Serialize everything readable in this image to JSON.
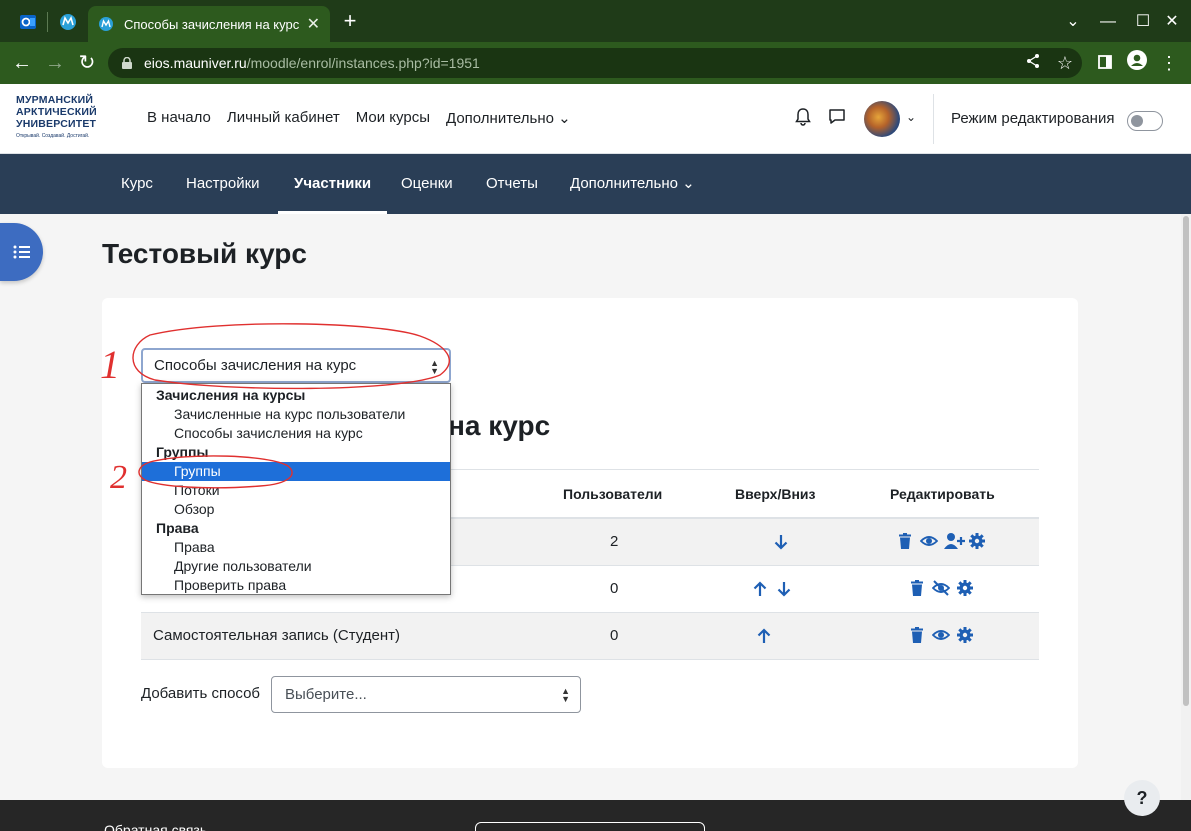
{
  "browser": {
    "tab_title": "Способы зачисления на курс",
    "tab_close": "✕",
    "new_tab": "+",
    "url_host": "eios.mauniver.ru",
    "url_path": "/moodle/enrol/instances.php?id=1951",
    "window_controls": [
      "⌄",
      "—",
      "☐",
      "✕"
    ]
  },
  "site": {
    "logo_lines": [
      "МУРМАНСКИЙ",
      "АРКТИЧЕСКИЙ",
      "УНИВЕРСИТЕТ"
    ],
    "logo_tagline": "Открывай. Создавай. Достигай.",
    "primary_nav": [
      "В начало",
      "Личный кабинет",
      "Мои курсы",
      "Дополнительно ⌄"
    ],
    "edit_mode_label": "Режим редактирования"
  },
  "secondary_nav": {
    "items": [
      "Курс",
      "Настройки",
      "Участники",
      "Оценки",
      "Отчеты",
      "Дополнительно ⌄"
    ],
    "active": "Участники"
  },
  "page": {
    "title": "Тестовый курс",
    "nav_select_value": "Способы зачисления на курс",
    "section_heading": "на курс",
    "add_method_label": "Добавить способ",
    "add_method_placeholder": "Выберите..."
  },
  "table": {
    "headers": [
      "Пользователи",
      "Вверх/Вниз",
      "Редактировать"
    ],
    "rows": [
      {
        "name": "",
        "users": "2"
      },
      {
        "name": "",
        "users": "0"
      },
      {
        "name": "Самостоятельная запись (Студент)",
        "users": "0"
      }
    ]
  },
  "dropdown": {
    "groups": [
      {
        "label": "Зачисления на курсы",
        "options": [
          "Зачисленные на курс пользователи",
          "Способы зачисления на курс"
        ]
      },
      {
        "label": "Группы",
        "options": [
          "Группы",
          "Потоки",
          "Обзор"
        ]
      },
      {
        "label": "Права",
        "options": [
          "Права",
          "Другие пользователи",
          "Проверить права"
        ]
      }
    ],
    "selected": "Группы"
  },
  "footer": {
    "feedback_label": "Обратная связь"
  },
  "help": {
    "label": "?"
  },
  "annotations": [
    "1",
    "2"
  ],
  "colors": {
    "browser_tabbar": "#1f3b18",
    "browser_toolbar": "#2d5a1e",
    "nav_dark": "#2a3e56",
    "accent_blue": "#3d6cc1",
    "icon_blue": "#1e5fb4",
    "selection_blue": "#1e6fd9",
    "annotation_red": "#e0302f"
  }
}
